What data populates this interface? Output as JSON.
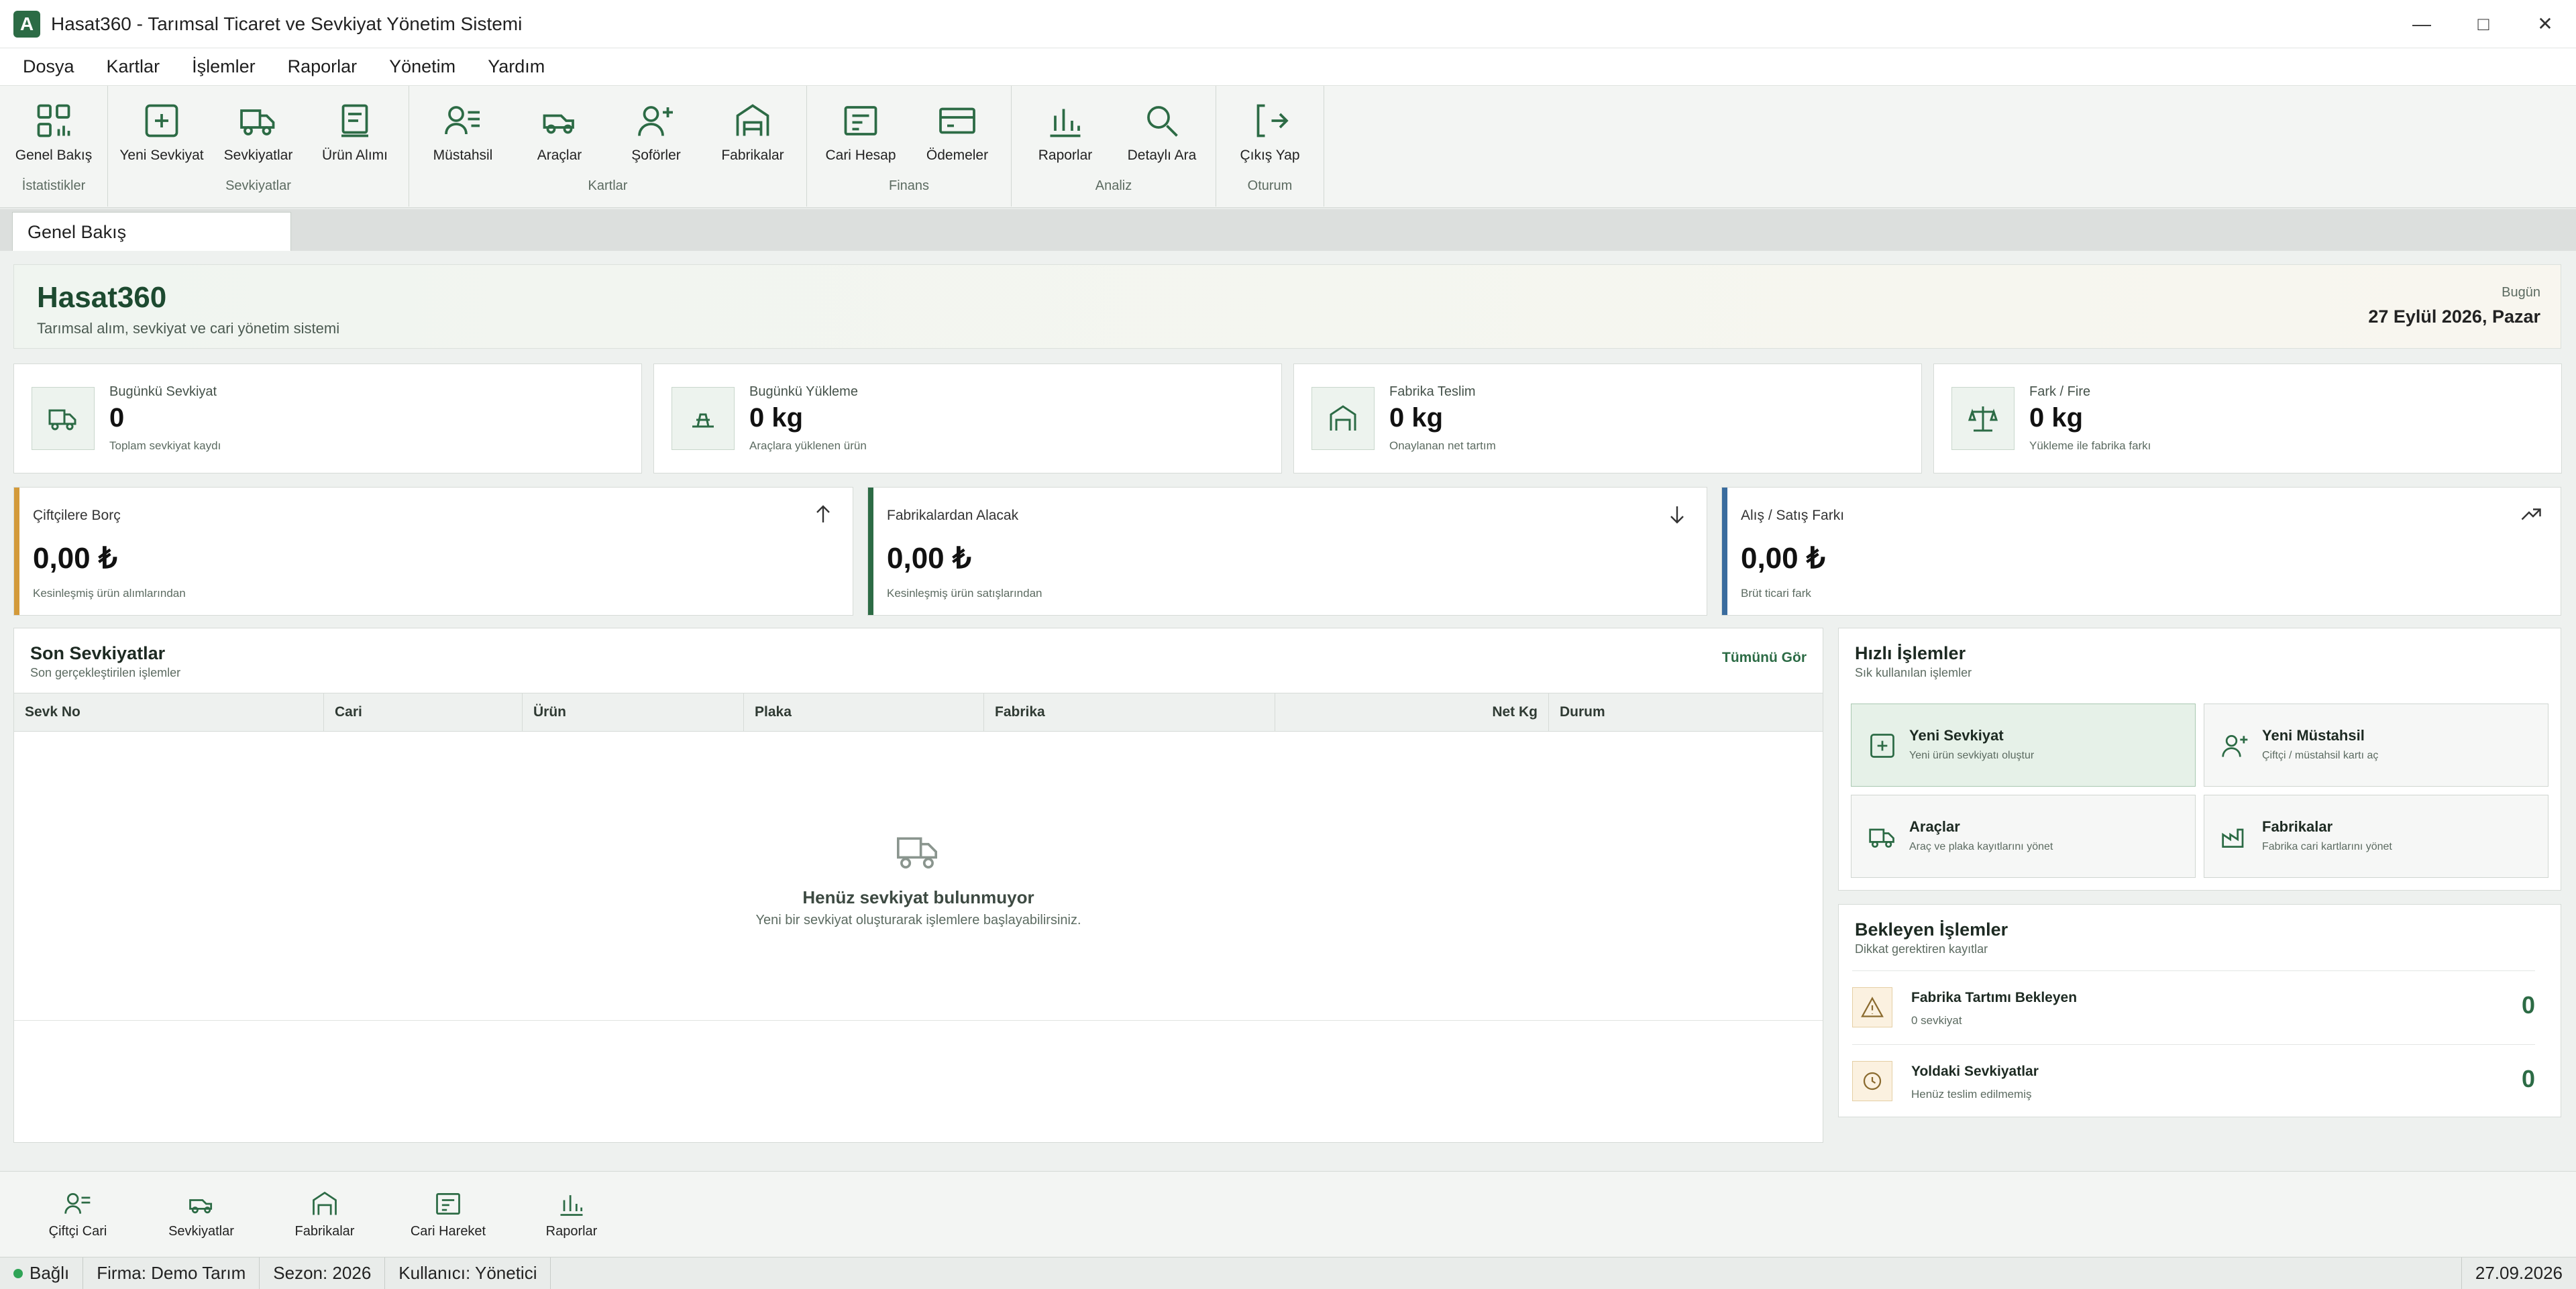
{
  "window": {
    "title": "Hasat360 - Tarımsal Ticaret ve Sevkiyat Yönetim Sistemi",
    "icon_letter": "A",
    "minimize": "—",
    "maximize": "□",
    "close": "✕"
  },
  "menu": [
    "Dosya",
    "Kartlar",
    "İşlemler",
    "Raporlar",
    "Yönetim",
    "Yardım"
  ],
  "ribbon": {
    "groups": [
      {
        "label": "İstatistikler",
        "buttons": [
          {
            "label": "Genel Bakış",
            "icon": "dashboard-icon"
          }
        ]
      },
      {
        "label": "Sevkiyatlar",
        "buttons": [
          {
            "label": "Yeni Sevkiyat",
            "icon": "plus-square-icon"
          },
          {
            "label": "Sevkiyatlar",
            "icon": "truck-icon"
          },
          {
            "label": "Ürün Alımı",
            "icon": "receipt-icon"
          }
        ]
      },
      {
        "label": "Kartlar",
        "buttons": [
          {
            "label": "Müstahsil",
            "icon": "user-list-icon"
          },
          {
            "label": "Araçlar",
            "icon": "car-icon"
          },
          {
            "label": "Şoförler",
            "icon": "user-plus-icon"
          },
          {
            "label": "Fabrikalar",
            "icon": "warehouse-icon"
          }
        ]
      },
      {
        "label": "Finans",
        "buttons": [
          {
            "label": "Cari Hesap",
            "icon": "ledger-icon"
          },
          {
            "label": "Ödemeler",
            "icon": "card-icon"
          }
        ]
      },
      {
        "label": "Analiz",
        "buttons": [
          {
            "label": "Raporlar",
            "icon": "bar-chart-icon"
          },
          {
            "label": "Detaylı Ara",
            "icon": "search-icon"
          }
        ]
      },
      {
        "label": "Oturum",
        "buttons": [
          {
            "label": "Çıkış Yap",
            "icon": "logout-icon"
          }
        ]
      }
    ]
  },
  "tab": {
    "label": "Genel Bakış"
  },
  "banner": {
    "title": "Hasat360",
    "subtitle": "Tarımsal alım, sevkiyat ve cari yönetim sistemi",
    "today_label": "Bugün",
    "date": "27 Eylül 2026, Pazar"
  },
  "stats": [
    {
      "label": "Bugünkü Sevkiyat",
      "value": "0",
      "sub": "Toplam sevkiyat kaydı",
      "icon": "truck-icon"
    },
    {
      "label": "Bugünkü Yükleme",
      "value": "0 kg",
      "sub": "Araçlara yüklenen ürün",
      "icon": "load-icon"
    },
    {
      "label": "Fabrika Teslim",
      "value": "0 kg",
      "sub": "Onaylanan net tartım",
      "icon": "warehouse-icon"
    },
    {
      "label": "Fark / Fire",
      "value": "0 kg",
      "sub": "Yükleme ile fabrika farkı",
      "icon": "scale-icon"
    }
  ],
  "finance": [
    {
      "label": "Çiftçilere Borç",
      "value": "0,00 ₺",
      "sub": "Kesinleşmiş ürün alımlarından",
      "color": "#d39a3a",
      "icon": "arrow-up-icon"
    },
    {
      "label": "Fabrikalardan Alacak",
      "value": "0,00 ₺",
      "sub": "Kesinleşmiş ürün satışlarından",
      "color": "#2c6b45",
      "icon": "arrow-down-icon"
    },
    {
      "label": "Alış / Satış Farkı",
      "value": "0,00 ₺",
      "sub": "Brüt ticari fark",
      "color": "#3a6c9e",
      "icon": "trend-up-icon"
    }
  ],
  "shipments": {
    "title": "Son Sevkiyatlar",
    "subtitle": "Son gerçekleştirilen işlemler",
    "see_all": "Tümünü Gör",
    "columns": [
      "Sevk No",
      "Cari",
      "Ürün",
      "Plaka",
      "Fabrika",
      "Net Kg",
      "Durum"
    ],
    "empty_title": "Henüz sevkiyat bulunmuyor",
    "empty_sub": "Yeni bir sevkiyat oluşturarak işlemlere başlayabilirsiniz."
  },
  "quick": {
    "title": "Hızlı İşlemler",
    "subtitle": "Sık kullanılan işlemler",
    "items": [
      {
        "label": "Yeni Sevkiyat",
        "sub": "Yeni ürün sevkiyatı oluştur",
        "icon": "plus-square-icon"
      },
      {
        "label": "Yeni Müstahsil",
        "sub": "Çiftçi / müstahsil kartı aç",
        "icon": "user-plus-icon"
      },
      {
        "label": "Araçlar",
        "sub": "Araç ve plaka kayıtlarını yönet",
        "icon": "truck-icon"
      },
      {
        "label": "Fabrikalar",
        "sub": "Fabrika cari kartlarını yönet",
        "icon": "factory-icon"
      }
    ]
  },
  "pending": {
    "title": "Bekleyen İşlemler",
    "subtitle": "Dikkat gerektiren kayıtlar",
    "items": [
      {
        "label": "Fabrika Tartımı Bekleyen",
        "sub": "0 sevkiyat",
        "count": "0",
        "icon": "warning-icon"
      },
      {
        "label": "Yoldaki Sevkiyatlar",
        "sub": "Henüz teslim edilmemiş",
        "count": "0",
        "icon": "clock-icon"
      }
    ]
  },
  "bottom_nav": [
    {
      "label": "Çiftçi Cari",
      "icon": "user-list-icon"
    },
    {
      "label": "Sevkiyatlar",
      "icon": "car-icon"
    },
    {
      "label": "Fabrikalar",
      "icon": "warehouse-icon"
    },
    {
      "label": "Cari Hareket",
      "icon": "ledger-icon"
    },
    {
      "label": "Raporlar",
      "icon": "bar-chart-icon"
    }
  ],
  "status": {
    "connection": "Bağlı",
    "company": "Firma: Demo Tarım",
    "season": "Sezon: 2026",
    "user": "Kullanıcı: Yönetici",
    "date": "27.09.2026"
  }
}
